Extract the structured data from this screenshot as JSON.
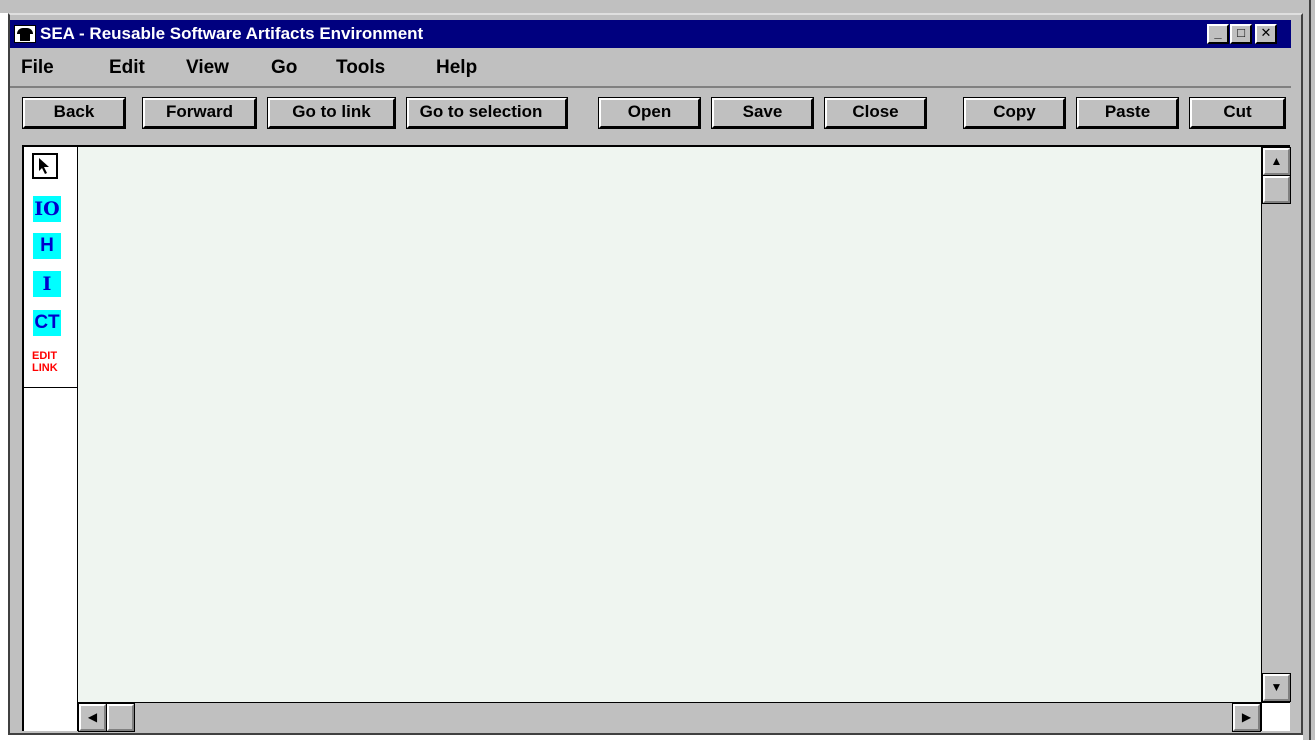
{
  "window": {
    "title": "SEA - Reusable Software Artifacts Environment",
    "controls": {
      "minimize": "_",
      "maximize": "□",
      "close": "✕"
    }
  },
  "menu": [
    "File",
    "Edit",
    "View",
    "Go",
    "Tools",
    "Help"
  ],
  "toolbar": {
    "back": "Back",
    "forward": "Forward",
    "go_to_link": "Go to link",
    "go_to_selection": "Go to selection",
    "open": "Open",
    "save": "Save",
    "close": "Close",
    "copy": "Copy",
    "paste": "Paste",
    "cut": "Cut"
  },
  "palette": {
    "select_icon": "arrow-pointer-icon",
    "tools": [
      "IO",
      "H",
      "I",
      "CT"
    ],
    "edit_link": [
      "EDIT",
      "LINK"
    ]
  },
  "colors": {
    "titlebar": "#00007f",
    "canvas": "#eff5f0",
    "tool_bg": "#00ffff",
    "tool_text": "#0000cc",
    "edit_link": "#ff0000"
  }
}
